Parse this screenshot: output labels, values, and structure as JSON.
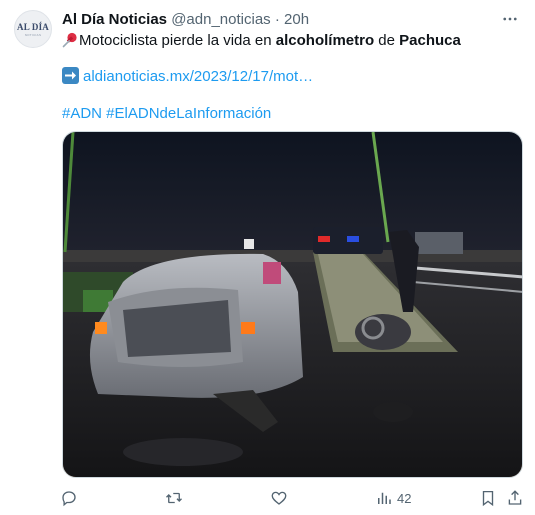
{
  "author": {
    "display_name": "Al Día Noticias",
    "handle": "@adn_noticias",
    "separator": "·",
    "time": "20h",
    "avatar_text": "AL DÍA",
    "avatar_subtext": "NOTICIAS"
  },
  "tweet": {
    "text_part1": "Motociclista pierde la vida en ",
    "text_bold1": "alcoholímetro",
    "text_part2": " de ",
    "text_bold2": "Pachuca",
    "link": "aldianoticias.mx/2023/12/17/mot…",
    "hashtags": "#ADN #ElADNdeLaInformación"
  },
  "actions": {
    "views_count": "42"
  },
  "icons": [
    "pushpin-icon",
    "arrow-right-icon",
    "more-icon",
    "reply-icon",
    "retweet-icon",
    "like-icon",
    "views-icon",
    "bookmark-icon",
    "share-icon"
  ],
  "colors": {
    "link": "#1d9bf0",
    "muted": "#536471",
    "text": "#0f1419"
  }
}
